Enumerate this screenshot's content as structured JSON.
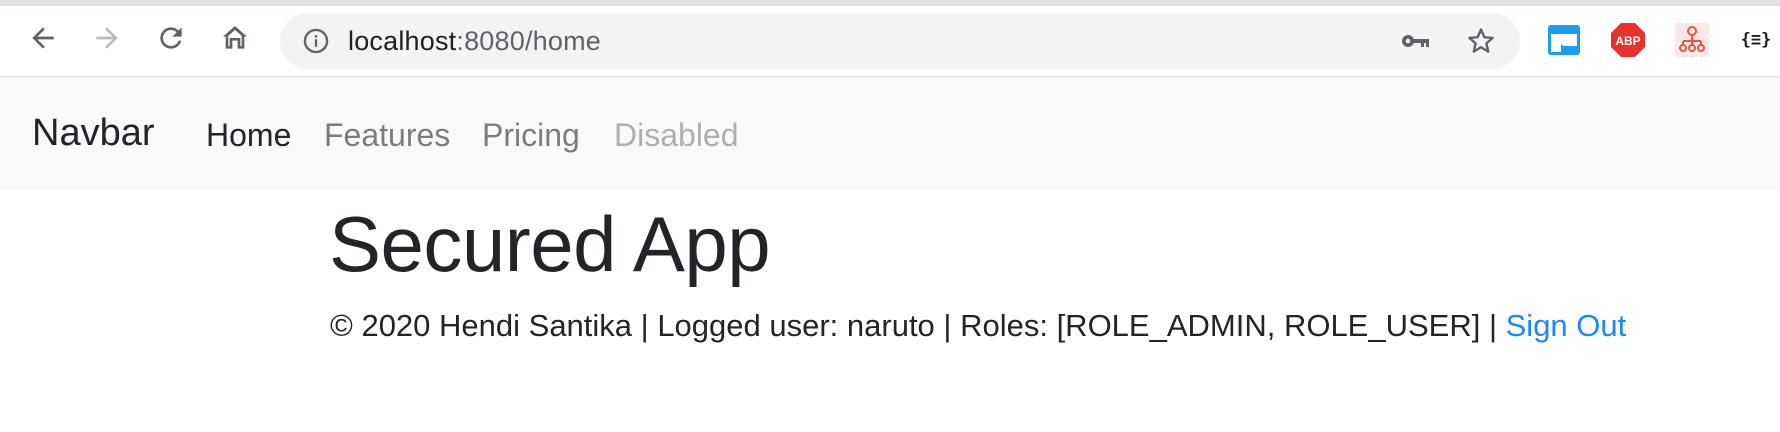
{
  "browser": {
    "url_host": "localhost",
    "url_rest": ":8080/home",
    "extensions": [
      {
        "name": "window-extension-icon",
        "color": "#1a9ff0"
      },
      {
        "name": "adblock-plus-icon",
        "label": "ABP",
        "color": "#e8302f"
      },
      {
        "name": "network-extension-icon",
        "color": "#e8553f"
      },
      {
        "name": "json-formatter-icon",
        "label": "{≡}"
      }
    ]
  },
  "navbar": {
    "brand": "Navbar",
    "links": [
      {
        "label": "Home",
        "state": "active"
      },
      {
        "label": "Features",
        "state": "normal"
      },
      {
        "label": "Pricing",
        "state": "normal"
      },
      {
        "label": "Disabled",
        "state": "disabled"
      }
    ]
  },
  "main": {
    "title": "Secured App",
    "footer": {
      "text": "© 2020 Hendi Santika | Logged user: naruto | Roles: [ROLE_ADMIN, ROLE_USER] | ",
      "signout": "Sign Out",
      "link_color": "#1a88f7"
    }
  }
}
